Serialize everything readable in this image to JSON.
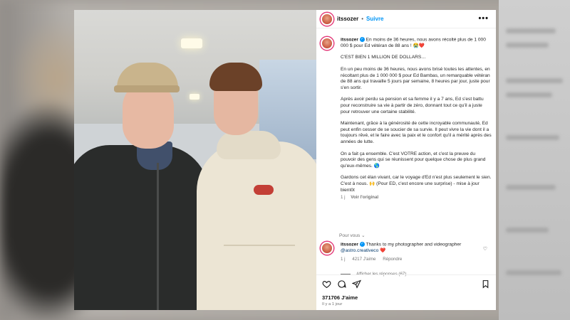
{
  "post": {
    "username": "itssozer",
    "follow_label": "Suivre",
    "more_label": "•••"
  },
  "caption": {
    "username": "itssozer",
    "headline": "En moins de 36 heures, nous avons récolté plus de 1 000 000 $ pour Ed vétéran de 88 ans ! 😭❤️",
    "paragraphs": [
      "C'EST BIEN 1 MILLION DE DOLLARS…",
      "En un peu moins de 36 heures, nous avons brisé toutes les attentes, en récoltant plus de 1 000 000 $ pour Ed Bambas, un remarquable vétéran de 88 ans qui travaille 5 jours par semaine, 8 heures par jour, juste pour s'en sortir.",
      "Après avoir perdu sa pension et sa femme il y a 7 ans, Ed s'est battu pour reconstruire sa vie à partir de zéro, donnant tout ce qu'il a juste pour retrouver une certaine stabilité.",
      "Maintenant, grâce à la générosité de cette incroyable communauté, Ed peut enfin cesser de se soucier de sa survie. Il peut vivre la vie dont il a toujours rêvé, et le faire avec la paix et le confort qu'il a mérité après des années de lutte.",
      "On a fait ça ensemble. C'est VOTRE action, et c'est la preuve du pouvoir des gens qui se réunissent pour quelque chose de plus grand qu'eux-mêmes. 🌎",
      "Gardons cet élan vivant, car le voyage d'Ed n'est plus seulement le sien. C'est à nous. 🙌 (Pour ED, c'est encore une surprise) - mise à jour bientôt"
    ],
    "age": "1 j",
    "translate_label": "Voir l'original"
  },
  "comments_label": "Pour vous ⌄",
  "comment": {
    "username": "itssozer",
    "text": "Thanks to my photographer and videographer",
    "mention": "@astro.creativeco",
    "emoji": "❤️",
    "age": "1 j",
    "likes": "4217 J'aime",
    "reply_label": "Répondre",
    "replies_label": "Afficher les réponses (67)"
  },
  "footer": {
    "likes": "371706 J'aime",
    "date": "Il y a 1 jour"
  },
  "colors": {
    "link": "#0095f6",
    "avatar_ring": "#e33a7a"
  }
}
